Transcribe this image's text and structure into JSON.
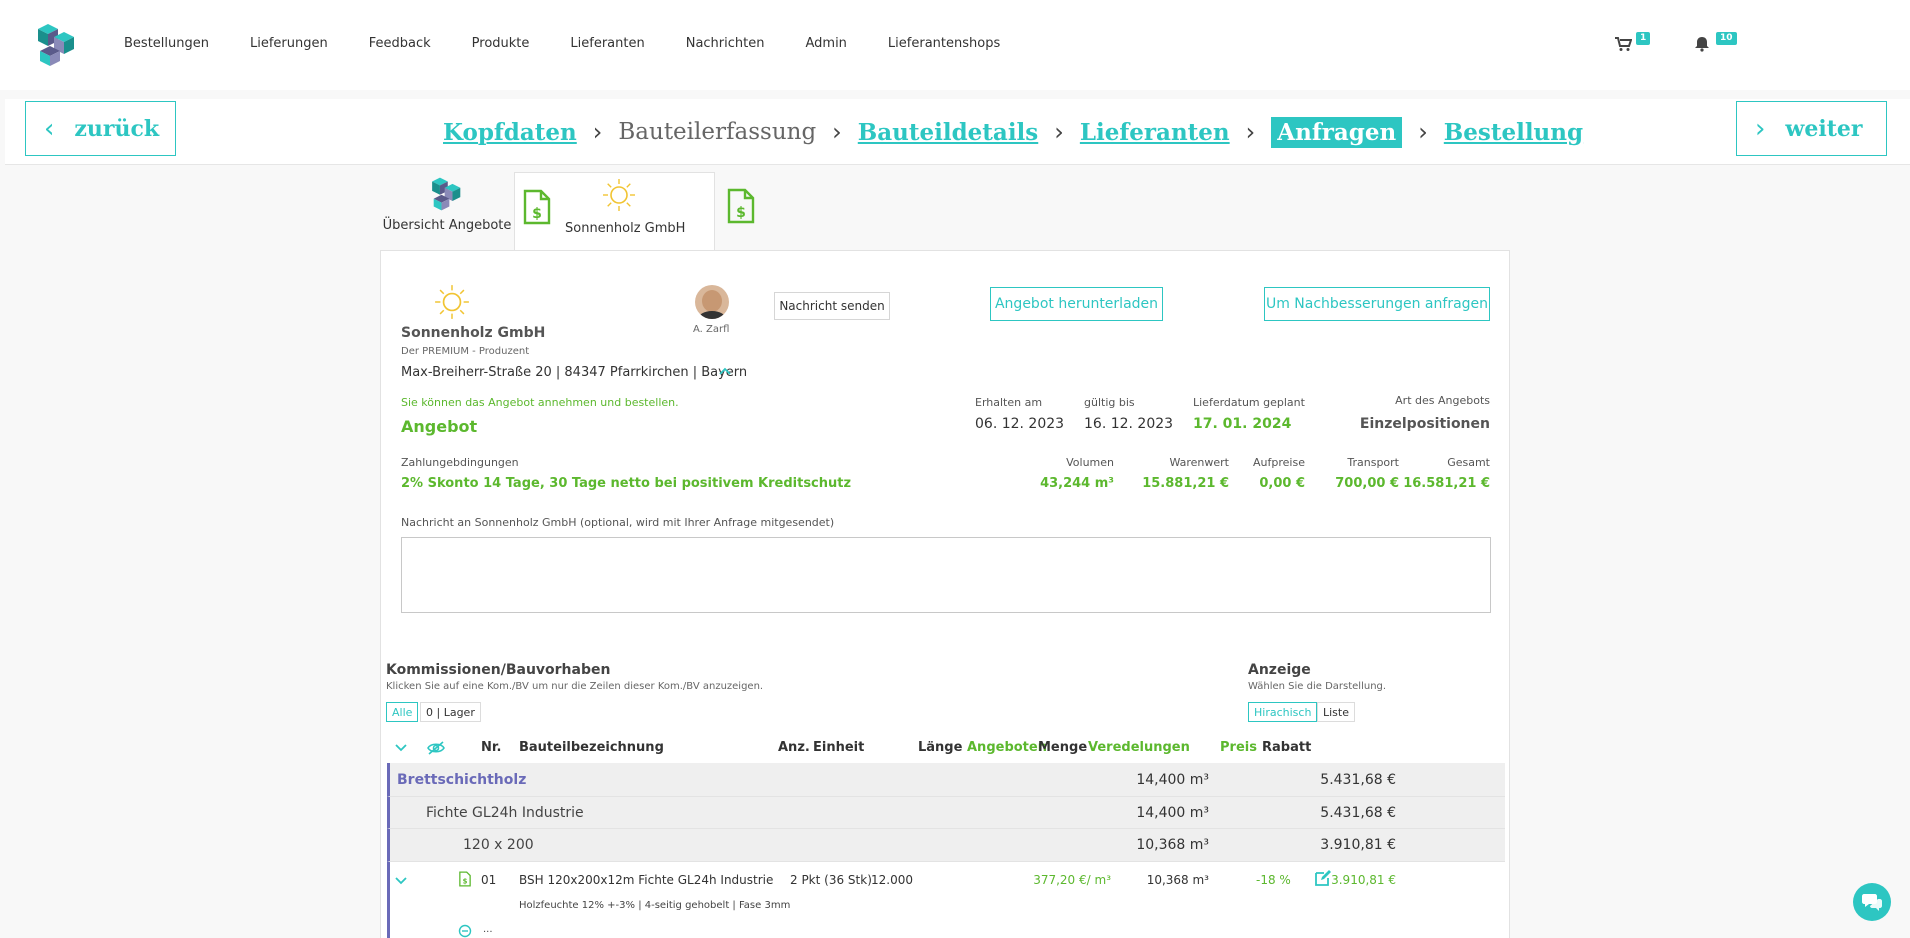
{
  "nav": {
    "items": [
      "Bestellungen",
      "Lieferungen",
      "Feedback",
      "Produkte",
      "Lieferanten",
      "Nachrichten",
      "Admin",
      "Lieferantenshops"
    ],
    "cart_count": "1",
    "notification_count": "10"
  },
  "steps": {
    "back_label": "zurück",
    "next_label": "weiter",
    "items": [
      "Kopfdaten",
      "Bauteilerfassung",
      "Bauteildetails",
      "Lieferanten",
      "Anfragen",
      "Bestellung"
    ]
  },
  "tabs": {
    "overview": "Übersicht Angebote",
    "supplier": "Sonnenholz GmbH"
  },
  "supplier": {
    "name": "Sonnenholz GmbH",
    "tagline": "Der PREMIUM - Produzent",
    "address": "Max-Breiherr-Straße 20 | 84347 Pfarrkirchen | Bayern",
    "contact": "A. Zarfl",
    "send_message": "Nachricht senden",
    "download_offer": "Angebot herunterladen",
    "request_improvements": "Um Nachbesserungen anfragen"
  },
  "offer": {
    "notice": "Sie können das Angebot annehmen und bestellen.",
    "title": "Angebot",
    "received_label": "Erhalten am",
    "received": "06. 12. 2023",
    "valid_label": "gültig bis",
    "valid": "16. 12. 2023",
    "delivery_label": "Lieferdatum geplant",
    "delivery": "17. 01. 2024",
    "type_label": "Art des Angebots",
    "type": "Einzelpositionen",
    "payment_label": "Zahlungebdingungen",
    "payment": "2% Skonto 14 Tage, 30 Tage netto bei positivem Kreditschutz",
    "volume_label": "Volumen",
    "volume": "43,244 m³",
    "goods_label": "Warenwert",
    "goods": "15.881,21 €",
    "surcharge_label": "Aufpreise",
    "surcharge": "0,00 €",
    "transport_label": "Transport",
    "transport": "700,00 €",
    "total_label": "Gesamt",
    "total": "16.581,21 €",
    "message_label": "Nachricht an Sonnenholz GmbH (optional, wird mit Ihrer Anfrage mitgesendet)"
  },
  "commissions": {
    "title": "Kommissionen/Bauvorhaben",
    "hint": "Klicken Sie auf eine Kom./BV um nur die Zeilen dieser Kom./BV anzuzeigen.",
    "all": "Alle",
    "lager": "0 | Lager"
  },
  "display": {
    "title": "Anzeige",
    "hint": "Wählen Sie die Darstellung.",
    "hierarchy": "Hirachisch",
    "list": "Liste"
  },
  "table": {
    "headers": {
      "nr": "Nr.",
      "name": "Bauteilbezeichnung",
      "qty": "Anz.",
      "unit": "Einheit",
      "length": "Länge",
      "offered": "Angeboten",
      "amount": "Menge",
      "finishing": "Veredelungen",
      "price": "Preis",
      "discount": "Rabatt"
    },
    "groups": [
      {
        "name": "Brettschichtholz",
        "amount": "14,400 m³",
        "price": "5.431,68 €"
      },
      {
        "name": "Fichte GL24h Industrie",
        "amount": "14,400 m³",
        "price": "5.431,68 €"
      },
      {
        "name": "120 x 200",
        "amount": "10,368 m³",
        "price": "3.910,81 €"
      }
    ],
    "row": {
      "nr": "01",
      "name": "BSH 120x200x12m Fichte GL24h Industrie",
      "qty": "2 Pkt (36 Stk)",
      "length": "12.000",
      "offered": "377,20 €/ m³",
      "amount": "10,368 m³",
      "price": "3.910,81 €",
      "discount": "-18 %",
      "details": "Holzfeuchte 12% +-3% | 4-seitig gehobelt | Fase 3mm",
      "more": "..."
    }
  },
  "colors": {
    "accent": "#2dc6c2",
    "green": "#5cb82e",
    "group_border": "#6a6ab8"
  }
}
